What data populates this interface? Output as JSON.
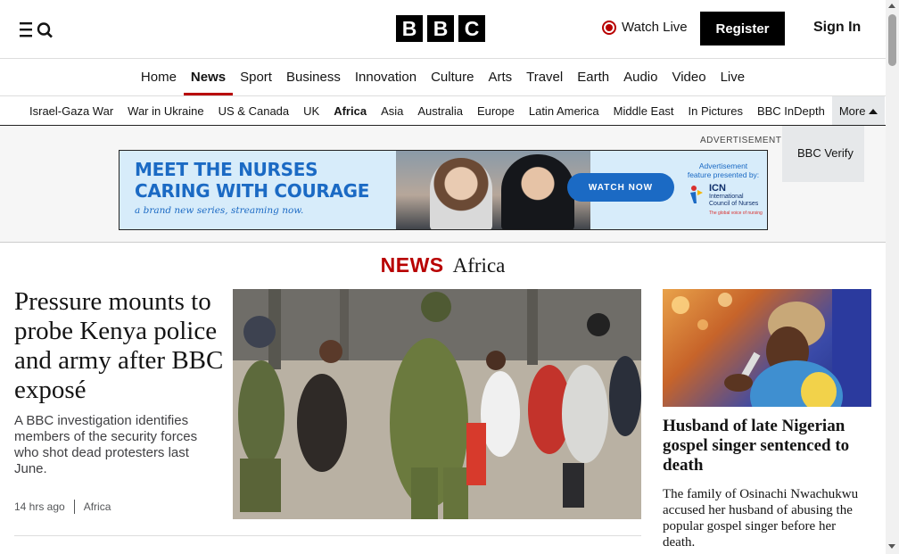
{
  "header": {
    "logo_letters": [
      "B",
      "B",
      "C"
    ],
    "watch_live": "Watch Live",
    "register": "Register",
    "sign_in": "Sign In"
  },
  "nav": {
    "items": [
      "Home",
      "News",
      "Sport",
      "Business",
      "Innovation",
      "Culture",
      "Arts",
      "Travel",
      "Earth",
      "Audio",
      "Video",
      "Live"
    ],
    "active": "News"
  },
  "subnav": {
    "items": [
      "Israel-Gaza War",
      "War in Ukraine",
      "US & Canada",
      "UK",
      "Africa",
      "Asia",
      "Australia",
      "Europe",
      "Latin America",
      "Middle East",
      "In Pictures",
      "BBC InDepth"
    ],
    "active": "Africa",
    "more_label": "More",
    "dropdown_item": "BBC Verify"
  },
  "ad": {
    "label": "ADVERTISEMENT",
    "headline_line1": "MEET THE NURSES",
    "headline_line2": "CARING WITH COURAGE",
    "tagline": "a brand new series, streaming now.",
    "cta": "WATCH NOW",
    "feature_line1": "Advertisement",
    "feature_line2": "feature presented by:",
    "sponsor_short": "ICN",
    "sponsor_line1": "International",
    "sponsor_line2": "Council of Nurses",
    "sponsor_tag": "The global voice of nursing"
  },
  "section": {
    "brand": "NEWS",
    "name": "Africa"
  },
  "lead_story": {
    "title": "Pressure mounts to probe Kenya police and army after BBC exposé",
    "summary": "A BBC investigation identifies members of the security forces who shot dead protesters last June.",
    "time": "14 hrs ago",
    "tag": "Africa"
  },
  "side_story": {
    "title": "Husband of late Nigerian gospel singer sentenced to death",
    "summary": "The family of Osinachi Nwachukwu accused her husband of abusing the popular gospel singer before her death."
  },
  "colors": {
    "brand_red": "#b80000",
    "black": "#000000",
    "ad_blue": "#1b6ac4",
    "ad_bg": "#d7ecfa"
  }
}
